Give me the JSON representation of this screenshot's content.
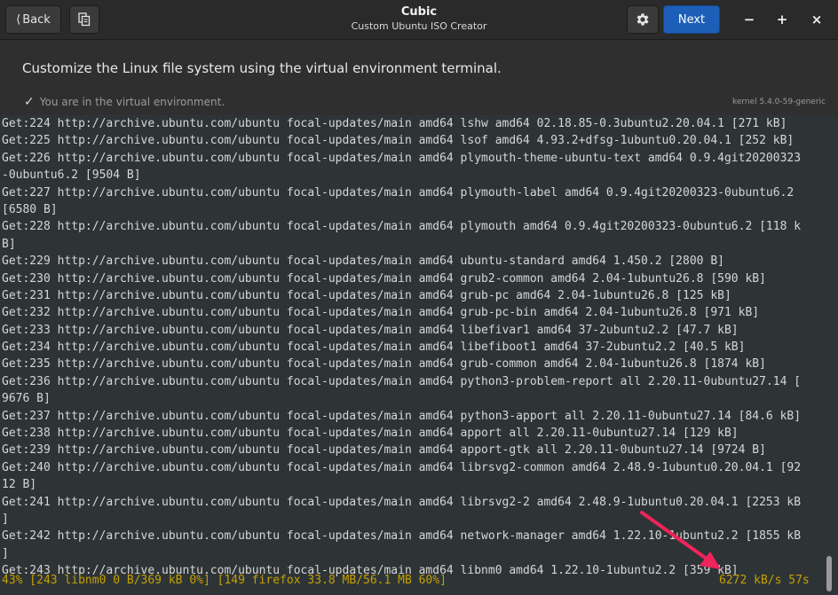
{
  "header": {
    "back_label": "Back",
    "next_label": "Next",
    "title": "Cubic",
    "subtitle": "Custom Ubuntu ISO Creator",
    "min_glyph": "−",
    "max_glyph": "+",
    "close_glyph": "×"
  },
  "page": {
    "description": "Customize the Linux file system using the virtual environment terminal.",
    "status": "You are in the virtual environment.",
    "kernel": "kernel 5.4.0-59-generic"
  },
  "terminal": {
    "lines": [
      "Get:224 http://archive.ubuntu.com/ubuntu focal-updates/main amd64 lshw amd64 02.18.85-0.3ubuntu2.20.04.1 [271 kB]",
      "Get:225 http://archive.ubuntu.com/ubuntu focal-updates/main amd64 lsof amd64 4.93.2+dfsg-1ubuntu0.20.04.1 [252 kB]",
      "Get:226 http://archive.ubuntu.com/ubuntu focal-updates/main amd64 plymouth-theme-ubuntu-text amd64 0.9.4git20200323",
      "-0ubuntu6.2 [9504 B]",
      "Get:227 http://archive.ubuntu.com/ubuntu focal-updates/main amd64 plymouth-label amd64 0.9.4git20200323-0ubuntu6.2",
      "[6580 B]",
      "Get:228 http://archive.ubuntu.com/ubuntu focal-updates/main amd64 plymouth amd64 0.9.4git20200323-0ubuntu6.2 [118 k",
      "B]",
      "Get:229 http://archive.ubuntu.com/ubuntu focal-updates/main amd64 ubuntu-standard amd64 1.450.2 [2800 B]",
      "Get:230 http://archive.ubuntu.com/ubuntu focal-updates/main amd64 grub2-common amd64 2.04-1ubuntu26.8 [590 kB]",
      "Get:231 http://archive.ubuntu.com/ubuntu focal-updates/main amd64 grub-pc amd64 2.04-1ubuntu26.8 [125 kB]",
      "Get:232 http://archive.ubuntu.com/ubuntu focal-updates/main amd64 grub-pc-bin amd64 2.04-1ubuntu26.8 [971 kB]",
      "Get:233 http://archive.ubuntu.com/ubuntu focal-updates/main amd64 libefivar1 amd64 37-2ubuntu2.2 [47.7 kB]",
      "Get:234 http://archive.ubuntu.com/ubuntu focal-updates/main amd64 libefiboot1 amd64 37-2ubuntu2.2 [40.5 kB]",
      "Get:235 http://archive.ubuntu.com/ubuntu focal-updates/main amd64 grub-common amd64 2.04-1ubuntu26.8 [1874 kB]",
      "Get:236 http://archive.ubuntu.com/ubuntu focal-updates/main amd64 python3-problem-report all 2.20.11-0ubuntu27.14 [",
      "9676 B]",
      "Get:237 http://archive.ubuntu.com/ubuntu focal-updates/main amd64 python3-apport all 2.20.11-0ubuntu27.14 [84.6 kB]",
      "Get:238 http://archive.ubuntu.com/ubuntu focal-updates/main amd64 apport all 2.20.11-0ubuntu27.14 [129 kB]",
      "Get:239 http://archive.ubuntu.com/ubuntu focal-updates/main amd64 apport-gtk all 2.20.11-0ubuntu27.14 [9724 B]",
      "Get:240 http://archive.ubuntu.com/ubuntu focal-updates/main amd64 librsvg2-common amd64 2.48.9-1ubuntu0.20.04.1 [92",
      "12 B]",
      "Get:241 http://archive.ubuntu.com/ubuntu focal-updates/main amd64 librsvg2-2 amd64 2.48.9-1ubuntu0.20.04.1 [2253 kB",
      "]",
      "Get:242 http://archive.ubuntu.com/ubuntu focal-updates/main amd64 network-manager amd64 1.22.10-1ubuntu2.2 [1855 kB",
      "]",
      "Get:243 http://archive.ubuntu.com/ubuntu focal-updates/main amd64 libnm0 amd64 1.22.10-1ubuntu2.2 [359 kB]"
    ],
    "progress_status": "43% [243 libnm0 0 B/369 kB 0%] [149 firefox 33.8 MB/56.1 MB 60%]",
    "rate": "6272 kB/s 57s"
  },
  "colors": {
    "accent": "#1d5fb8",
    "terminal_bg": "#2e3436",
    "status_text": "#c4a000",
    "arrow": "#f0245a"
  }
}
